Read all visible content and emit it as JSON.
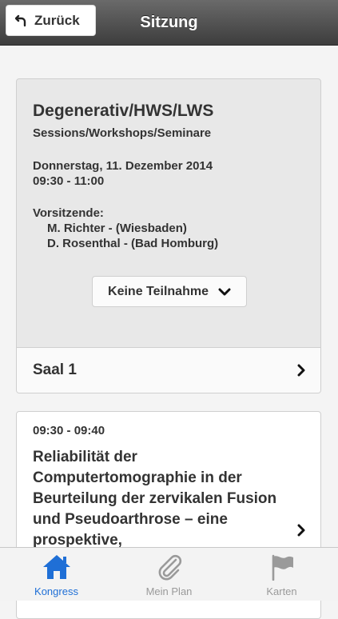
{
  "header": {
    "back_label": "Zurück",
    "title": "Sitzung"
  },
  "session": {
    "title": "Degenerativ/HWS/LWS",
    "type": "Sessions/Workshops/Seminare",
    "date": "Donnerstag, 11. Dezember 2014",
    "time": "09:30 - 11:00",
    "chairs_label": "Vorsitzende:",
    "chairs": [
      "M. Richter - (Wiesbaden)",
      "D. Rosenthal - (Bad Homburg)"
    ],
    "participation_label": "Keine Teilnahme",
    "room": "Saal 1"
  },
  "talk": {
    "time": "09:30 - 09:40",
    "title": "Reliabilität der Computertomographie in der Beurteilung der zervikalen Fusion und Pseudoarthrose – eine prospektive,"
  },
  "tabbar": {
    "items": [
      {
        "label": "Kongress",
        "icon": "home-icon",
        "active": true
      },
      {
        "label": "Mein Plan",
        "icon": "paperclip-icon",
        "active": false
      },
      {
        "label": "Karten",
        "icon": "flag-icon",
        "active": false
      }
    ]
  },
  "colors": {
    "accent": "#1f6fd6",
    "header_bg": "#4a4a4a",
    "inactive_tab": "#9a9a9a"
  }
}
